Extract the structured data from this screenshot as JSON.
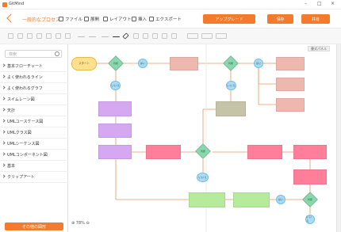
{
  "window": {
    "app_name": "GitMind",
    "controls": [
      "–",
      "□",
      "×"
    ]
  },
  "header": {
    "doc_title": "一般的なプロセス",
    "menus": [
      {
        "label": "ファイル",
        "icon": "file-icon"
      },
      {
        "label": "展開",
        "icon": "expand-icon"
      },
      {
        "label": "レイアウト",
        "icon": "layout-icon"
      },
      {
        "label": "挿入",
        "icon": "insert-icon"
      },
      {
        "label": "エクスポート",
        "icon": "export-icon"
      }
    ],
    "upgrade_label": "アップグレード",
    "save_label": "保存",
    "share_label": "共有"
  },
  "sidebar": {
    "search_placeholder": "検索",
    "items": [
      {
        "label": "基本フローチャート"
      },
      {
        "label": "よく使われるライン"
      },
      {
        "label": "よく使われるグラフ"
      },
      {
        "label": "スイムレーン図"
      },
      {
        "label": "天計"
      },
      {
        "label": "UMLユースケース図"
      },
      {
        "label": "UMLクラス図"
      },
      {
        "label": "UMLシーケンス図"
      },
      {
        "label": "UMLコンポーネント図"
      },
      {
        "label": "基本"
      },
      {
        "label": "クリップアート"
      }
    ],
    "more_label": "その他の図形"
  },
  "canvas": {
    "zoom_label": "78%",
    "panel_toggle_label": "書式パネル",
    "nodes": [
      {
        "kind": "terminal",
        "text": "スタート"
      },
      {
        "kind": "decision",
        "text": "判断"
      },
      {
        "kind": "connector",
        "text": "はい"
      },
      {
        "kind": "connector",
        "text": "いいえ"
      },
      {
        "kind": "decision",
        "text": "判断"
      },
      {
        "kind": "connector",
        "text": "はい"
      },
      {
        "kind": "connector",
        "text": "いいえ"
      },
      {
        "kind": "decision",
        "text": "判断"
      },
      {
        "kind": "connector",
        "text": "いいえ"
      },
      {
        "kind": "decision",
        "text": "判断"
      },
      {
        "kind": "connector",
        "text": "はい"
      },
      {
        "kind": "connector",
        "text": "いいえ"
      }
    ]
  },
  "colors": {
    "accent": "#f37b2b",
    "salmon": "#efb8ae",
    "purple": "#d7a8f2",
    "pink": "#ff7f9b",
    "green": "#b6eb9c",
    "olive": "#c5c4a9",
    "diamond": "#89d7ad",
    "connector": "#a9ddf7",
    "terminal": "#ffe08c",
    "edge": "#e59a62"
  }
}
